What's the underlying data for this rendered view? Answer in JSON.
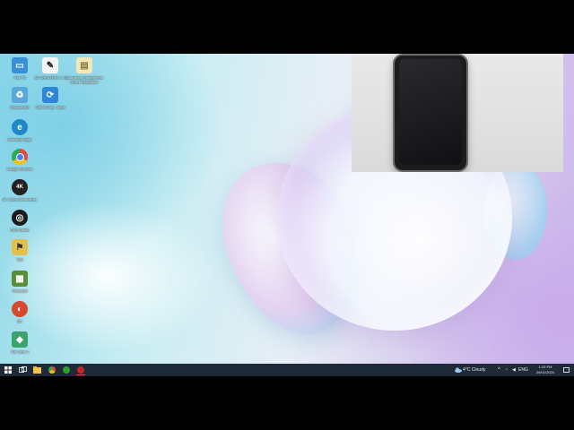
{
  "desktop_icons": [
    {
      "name": "this-pc-icon",
      "label": "This PC",
      "color": "#3b8fd6",
      "glyph": "▭"
    },
    {
      "name": "file-icon-1",
      "label": "3D CREATOR 2 1.0",
      "color": "#f4f4f4",
      "glyph": "✎"
    },
    {
      "name": "folder-icon",
      "label": "Saumsung Smartphone Driver Installation",
      "color": "#f1e7b8",
      "glyph": "▤"
    },
    {
      "name": "recycle-bin-icon",
      "label": "Recycle Bin",
      "color": "#5aa7dc",
      "glyph": "♻"
    },
    {
      "name": "update-app-icon",
      "label": "Call of Duty - Apps",
      "color": "#2f86d8",
      "glyph": "⟳"
    },
    {
      "name": "edge-icon",
      "label": "Microsoft Edge",
      "color": "#1e88c8",
      "glyph": "e"
    },
    {
      "name": "chrome-icon",
      "label": "Google Chrome",
      "color": "#e04b3c",
      "glyph": "◉"
    },
    {
      "name": "4k-downloader-icon",
      "label": "4K Video Downloader",
      "color": "#222",
      "glyph": "4K"
    },
    {
      "name": "obs-icon",
      "label": "OBS Studio",
      "color": "#1b1b1b",
      "glyph": "◎"
    },
    {
      "name": "tool-icon",
      "label": "Tool",
      "color": "#e3c04a",
      "glyph": "⚑"
    },
    {
      "name": "minecraft-icon",
      "label": "Minecraft",
      "color": "#5a8f3a",
      "glyph": "▦"
    },
    {
      "name": "app-icon-red",
      "label": "BC",
      "color": "#d8482f",
      "glyph": "◐"
    },
    {
      "name": "sims-icon",
      "label": "The Sims 4",
      "color": "#3aa56b",
      "glyph": "◆"
    }
  ],
  "taskbar": {
    "weather": "4°C  Cloudy",
    "language": "ENG",
    "time": "1:23 PM",
    "date": "26/01/2024"
  }
}
